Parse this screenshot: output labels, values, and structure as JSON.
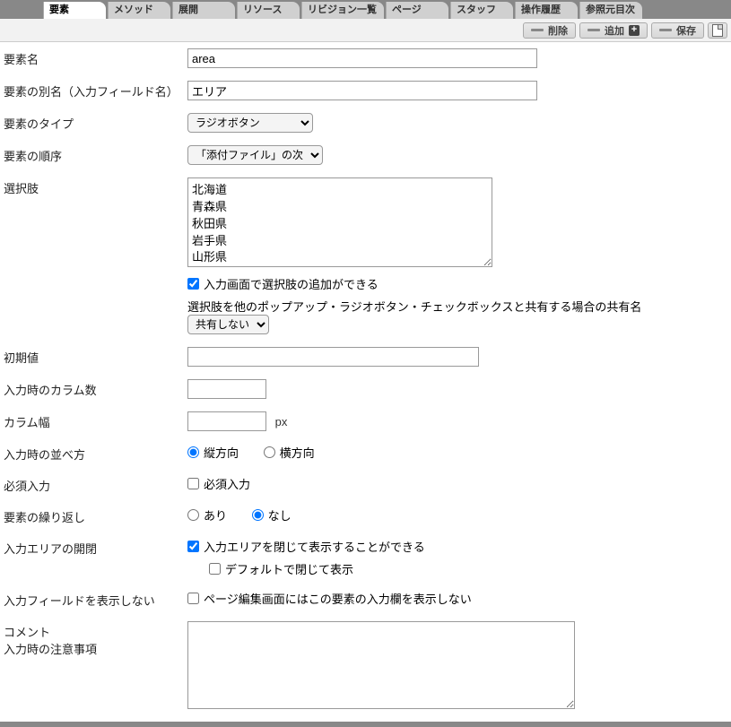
{
  "tabs": [
    "要素",
    "メソッド",
    "展開",
    "リソース",
    "リビジョン一覧",
    "ページ",
    "スタッフ",
    "操作履歴",
    "参照元目次"
  ],
  "toolbar": {
    "delete": "削除",
    "add": "追加",
    "save": "保存"
  },
  "labels": {
    "name": "要素名",
    "alias": "要素の別名（入力フィールド名）",
    "type": "要素のタイプ",
    "order": "要素の順序",
    "choices": "選択肢",
    "addChoice": "入力画面で選択肢の追加ができる",
    "shareLabel": "選択肢を他のポップアップ・ラジオボタン・チェックボックスと共有する場合の共有名",
    "shareSelect": "共有しない",
    "initial": "初期値",
    "columns": "入力時のカラム数",
    "colwidth": "カラム幅",
    "px": "px",
    "orientation": "入力時の並べ方",
    "vert": "縦方向",
    "horz": "横方向",
    "required": "必須入力",
    "requiredOpt": "必須入力",
    "repeat": "要素の繰り返し",
    "yes": "あり",
    "no": "なし",
    "collapse": "入力エリアの開閉",
    "collapseOpt": "入力エリアを閉じて表示することができる",
    "collapseDefault": "デフォルトで閉じて表示",
    "hideField": "入力フィールドを表示しない",
    "hideFieldOpt": "ページ編集画面にはこの要素の入力欄を表示しない",
    "comment": "コメント",
    "commentSub": "入力時の注意事項"
  },
  "values": {
    "name": "area",
    "alias": "エリア",
    "type": "ラジオボタン",
    "order": "「添付ファイル」の次",
    "choices": "北海道\n青森県\n秋田県\n岩手県\n山形県",
    "addChoice": true,
    "initial": "",
    "columns": "",
    "colwidth": "",
    "orientation": "vert",
    "required": false,
    "repeat": "no",
    "collapse": true,
    "collapseDefault": false,
    "hideField": false,
    "comment": ""
  }
}
